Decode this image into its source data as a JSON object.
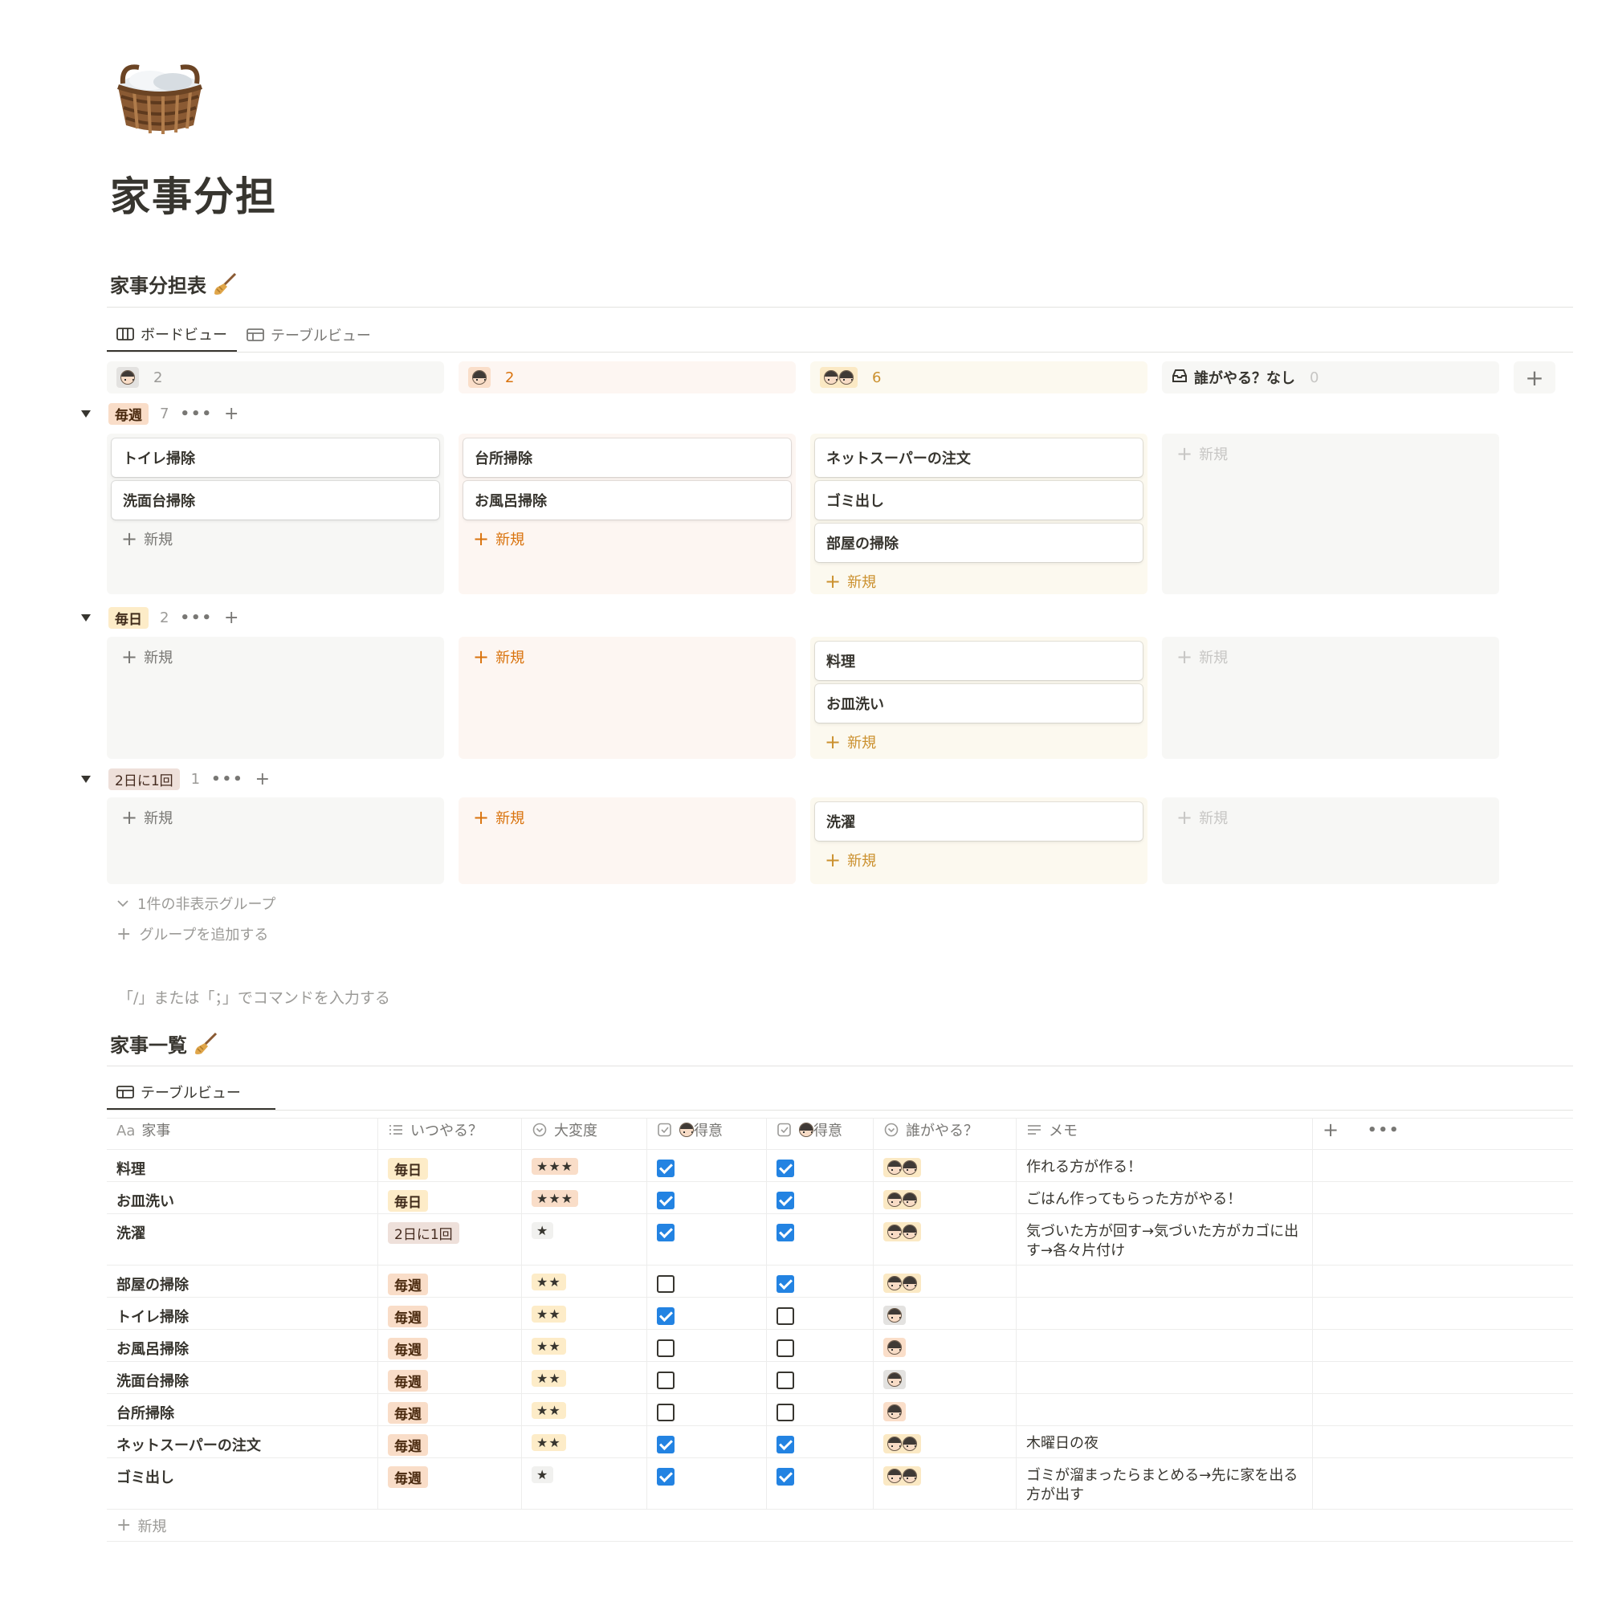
{
  "page": {
    "title": "家事分担",
    "icon": "laundry-basket-icon"
  },
  "board_section": {
    "title": "家事分担表",
    "tabs": [
      {
        "label": "ボードビュー",
        "icon": "board-icon",
        "active": true
      },
      {
        "label": "テーブルビュー",
        "icon": "table-icon",
        "active": false
      }
    ],
    "columns": [
      {
        "who": "boy",
        "count": "2",
        "bg": "#f7f7f5",
        "chip": "#e3e2e0",
        "count_color": "#9b9a97"
      },
      {
        "who": "girl",
        "count": "2",
        "bg": "#fdf6f2",
        "chip": "#fadec9",
        "count_color": "#d9730d"
      },
      {
        "who": "both",
        "count": "6",
        "bg": "#fcf9ef",
        "chip": "#fbe9c4",
        "count_color": "#cb912f"
      },
      {
        "who": "none",
        "label": "誰がやる？なし",
        "count": "0",
        "bg": "#f7f7f5",
        "count_color": "#c7c6c4"
      }
    ],
    "add_column": "+",
    "new_label": "新規",
    "groups": [
      {
        "tag": "毎週",
        "cls": "weekly",
        "count": "7",
        "cells": [
          [
            "トイレ掃除",
            "洗面台掃除"
          ],
          [
            "台所掃除",
            "お風呂掃除"
          ],
          [
            "ネットスーパーの注文",
            "ゴミ出し",
            "部屋の掃除"
          ],
          []
        ]
      },
      {
        "tag": "毎日",
        "cls": "daily",
        "count": "2",
        "cells": [
          [],
          [],
          [
            "料理",
            "お皿洗い"
          ],
          []
        ]
      },
      {
        "tag": "2日に1回",
        "cls": "every2",
        "count": "1",
        "cells": [
          [],
          [],
          [
            "洗濯"
          ],
          []
        ]
      }
    ],
    "hidden_groups": "1件の非表示グループ",
    "add_group": "グループを追加する"
  },
  "command_hint": "「/」または「；」でコマンドを入力する",
  "table_section": {
    "title": "家事一覧",
    "tab": {
      "label": "テーブルビュー",
      "icon": "table-icon"
    },
    "headers": [
      {
        "label": "家事",
        "icon": "Aa"
      },
      {
        "label": "いつやる？",
        "icon": "list-icon"
      },
      {
        "label": "大変度",
        "icon": "select-icon"
      },
      {
        "label": "得意",
        "icon": "checkbox-icon",
        "who": "boy"
      },
      {
        "label": "得意",
        "icon": "checkbox-icon",
        "who": "girl"
      },
      {
        "label": "誰がやる？",
        "icon": "select-icon"
      },
      {
        "label": "メモ",
        "icon": "text-icon"
      }
    ],
    "rows": [
      {
        "name": "料理",
        "when": "毎日",
        "when_cls": "daily",
        "stars": "★★★",
        "boy_good": true,
        "girl_good": true,
        "who": "both",
        "memo": "作れる方が作る！"
      },
      {
        "name": "お皿洗い",
        "when": "毎日",
        "when_cls": "daily",
        "stars": "★★★",
        "boy_good": true,
        "girl_good": true,
        "who": "both",
        "memo": "ごはん作ってもらった方がやる！"
      },
      {
        "name": "洗濯",
        "when": "2日に1回",
        "when_cls": "every2",
        "stars": "★",
        "boy_good": true,
        "girl_good": true,
        "who": "both",
        "memo": "気づいた方が回す→気づいた方がカゴに出す→各々片付け"
      },
      {
        "name": "部屋の掃除",
        "when": "毎週",
        "when_cls": "weekly",
        "stars": "★★",
        "boy_good": false,
        "girl_good": true,
        "who": "both",
        "memo": ""
      },
      {
        "name": "トイレ掃除",
        "when": "毎週",
        "when_cls": "weekly",
        "stars": "★★",
        "boy_good": true,
        "girl_good": false,
        "who": "boy",
        "memo": ""
      },
      {
        "name": "お風呂掃除",
        "when": "毎週",
        "when_cls": "weekly",
        "stars": "★★",
        "boy_good": false,
        "girl_good": false,
        "who": "girl",
        "memo": ""
      },
      {
        "name": "洗面台掃除",
        "when": "毎週",
        "when_cls": "weekly",
        "stars": "★★",
        "boy_good": false,
        "girl_good": false,
        "who": "boy",
        "memo": ""
      },
      {
        "name": "台所掃除",
        "when": "毎週",
        "when_cls": "weekly",
        "stars": "★★",
        "boy_good": false,
        "girl_good": false,
        "who": "girl",
        "memo": ""
      },
      {
        "name": "ネットスーパーの注文",
        "when": "毎週",
        "when_cls": "weekly",
        "stars": "★★",
        "boy_good": true,
        "girl_good": true,
        "who": "both",
        "memo": "木曜日の夜"
      },
      {
        "name": "ゴミ出し",
        "when": "毎週",
        "when_cls": "weekly",
        "stars": "★",
        "boy_good": true,
        "girl_good": true,
        "who": "both",
        "memo": "ゴミが溜まったらまとめる→先に家を出る方が出す"
      }
    ],
    "add_prop": "+",
    "more": "•••",
    "new_label": "新規"
  },
  "colors": {
    "accent_blue": "#2383e2",
    "orange_text": "#d9730d",
    "yellow_text": "#cb912f"
  }
}
